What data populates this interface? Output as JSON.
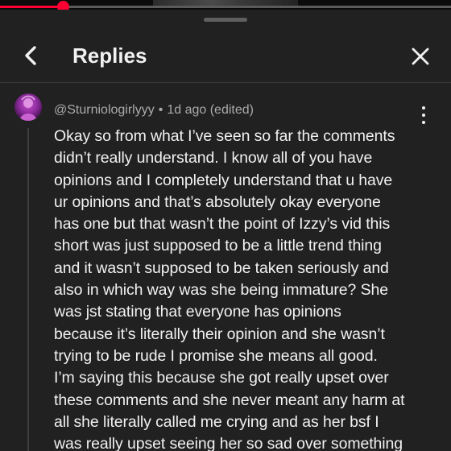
{
  "player": {
    "progress_fraction": 0.14,
    "accent_color": "#ff0033"
  },
  "header": {
    "title": "Replies",
    "back_icon": "chevron-left-icon",
    "close_icon": "close-icon"
  },
  "comment": {
    "author": "@Sturniologirlyyy",
    "separator": "•",
    "time": "1d ago (edited)",
    "menu_icon": "more-vert-icon",
    "lines": [
      "Okay so from what I’ve seen so far the comments",
      "didn’t really understand. I know all of you have",
      "opinions and I completely understand that u have",
      "ur opinions and that’s absolutely okay everyone",
      "has one but that wasn’t the point of Izzy’s vid this",
      "short was just supposed to be a little trend thing",
      "and it wasn’t supposed to be taken seriously and",
      "also in which way was she being immature? She",
      "was jst stating that everyone has opinions",
      "because it’s literally their opinion and she wasn’t",
      "trying to be rude I promise she means all good.",
      "I’m saying this because she got really upset over",
      "these comments and she never meant any harm at",
      "all she literally called me crying and as her bsf I",
      "was really upset seeing her so sad over something"
    ]
  }
}
